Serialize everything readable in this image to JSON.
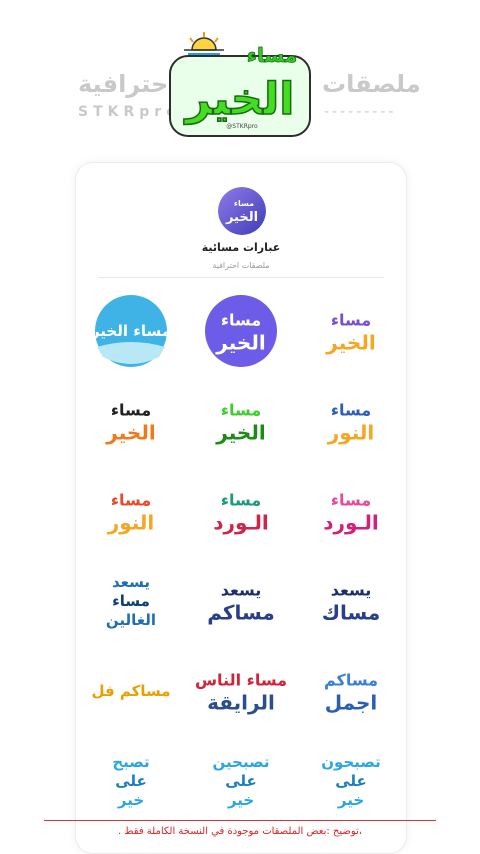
{
  "header": {
    "watermark_ar_left": "احترافية",
    "watermark_en_left": "STKRpro",
    "watermark_ar_right": "ملصقات",
    "watermark_dashes": "---------",
    "logo": {
      "top_text": "مساء",
      "main_text": "الخير",
      "handle": "@STKRpro"
    }
  },
  "pack": {
    "title": "عبارات مسائية",
    "subtitle": "ملصقات احترافية",
    "icon_top": "مساء",
    "icon_main": "الخير"
  },
  "stickers": [
    {
      "name": "masaa-alkhair-purple",
      "lines": [
        "مساء",
        "الخير"
      ],
      "colors": [
        "#7b4fd1",
        "#f6a623"
      ]
    },
    {
      "name": "masaa-alkhair-purple-circle",
      "lines": [
        "مساء",
        "الخير"
      ],
      "colors": [
        "#ffffff",
        "#6c5ce7"
      ]
    },
    {
      "name": "masaa-alkhair-sea-circle",
      "lines": [
        "مساء الخير"
      ],
      "colors": [
        "#ffffff",
        "#3fb3e6"
      ]
    },
    {
      "name": "masaa-alnoor-blue",
      "lines": [
        "مساء",
        "النور"
      ],
      "colors": [
        "#2b5fb8",
        "#f5a623"
      ]
    },
    {
      "name": "masaa-alkhair-green",
      "lines": [
        "مساء",
        "الخير"
      ],
      "colors": [
        "#3ccf2e",
        "#1e8a18"
      ]
    },
    {
      "name": "masaa-alkhair-orange",
      "lines": [
        "مساء",
        "الخير"
      ],
      "colors": [
        "#222222",
        "#f07a1a"
      ]
    },
    {
      "name": "masaa-alward-pink",
      "lines": [
        "مساء",
        "الـورد"
      ],
      "colors": [
        "#e84a9a",
        "#d21f7a"
      ]
    },
    {
      "name": "masaa-alward-rose",
      "lines": [
        "مساء",
        "الـورد"
      ],
      "colors": [
        "#1a9c7a",
        "#d2234a"
      ]
    },
    {
      "name": "masaa-alnoor-orange",
      "lines": [
        "مساء",
        "النور"
      ],
      "colors": [
        "#e84a2a",
        "#f5a623"
      ]
    },
    {
      "name": "yisid-masak-navy",
      "lines": [
        "يسعد",
        "مساك"
      ],
      "colors": [
        "#1b2f6e",
        "#2a3f8a"
      ]
    },
    {
      "name": "yisid-masakum-navy",
      "lines": [
        "يسعد",
        "مساكم"
      ],
      "colors": [
        "#1b2f6e",
        "#2a3f8a"
      ]
    },
    {
      "name": "yisid-masaa-alghalin",
      "lines": [
        "يسعد",
        "مساء",
        "الغالين"
      ],
      "colors": [
        "#1f6fb5",
        "#0f3f7a"
      ]
    },
    {
      "name": "masakum-ajmal-outline",
      "lines": [
        "مساكم",
        "اجمل"
      ],
      "colors": [
        "#3b7fd6",
        "#2a5fb0"
      ]
    },
    {
      "name": "masaa-alnas-alraiqa",
      "lines": [
        "مساء الناس",
        "الرايقة"
      ],
      "colors": [
        "#d2233a",
        "#2a4f8a"
      ]
    },
    {
      "name": "masakum-fal-colorful",
      "lines": [
        "مساكم فل"
      ],
      "colors": [
        "#e8a000",
        "#2a9c3a"
      ]
    },
    {
      "name": "tusbihun-ala-khair-1",
      "lines": [
        "تصبحون",
        "على",
        "خير"
      ],
      "colors": [
        "#2aa6e0",
        "#1b7fc0"
      ]
    },
    {
      "name": "tusbihin-ala-khair",
      "lines": [
        "تصبحين",
        "على",
        "خير"
      ],
      "colors": [
        "#2aa6e0",
        "#1b7fc0"
      ]
    },
    {
      "name": "tusbih-ala-khair",
      "lines": [
        "تصبح",
        "على",
        "خير"
      ],
      "colors": [
        "#2aa6e0",
        "#1b7fc0"
      ]
    }
  ],
  "footer": {
    "note": "،توضيح :بعض الملصقات موجودة في النسخة الكاملة فقط ."
  }
}
